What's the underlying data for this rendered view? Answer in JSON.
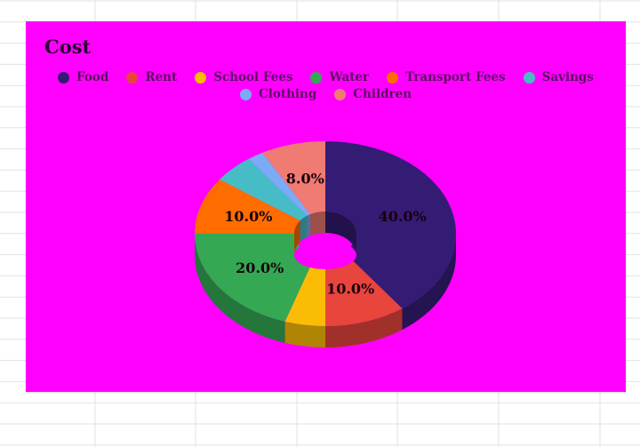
{
  "chart_data": {
    "type": "pie",
    "variant": "3d-donut",
    "title": "Cost",
    "legend_position": "top",
    "categories": [
      "Food",
      "Rent",
      "School Fees",
      "Water",
      "Transport Fees",
      "Savings",
      "Clothing",
      "Children"
    ],
    "values": [
      40,
      10,
      5,
      20,
      10,
      5,
      2,
      8
    ],
    "labels": [
      "40.0%",
      "10.0%",
      "",
      "20.0%",
      "10.0%",
      "",
      "",
      "8.0%"
    ],
    "colors": [
      "#341c74",
      "#e8453c",
      "#fbbc05",
      "#34a853",
      "#ff6d01",
      "#46bdc6",
      "#7baaf7",
      "#f07b72"
    ],
    "background_color": "#ff00ff"
  }
}
